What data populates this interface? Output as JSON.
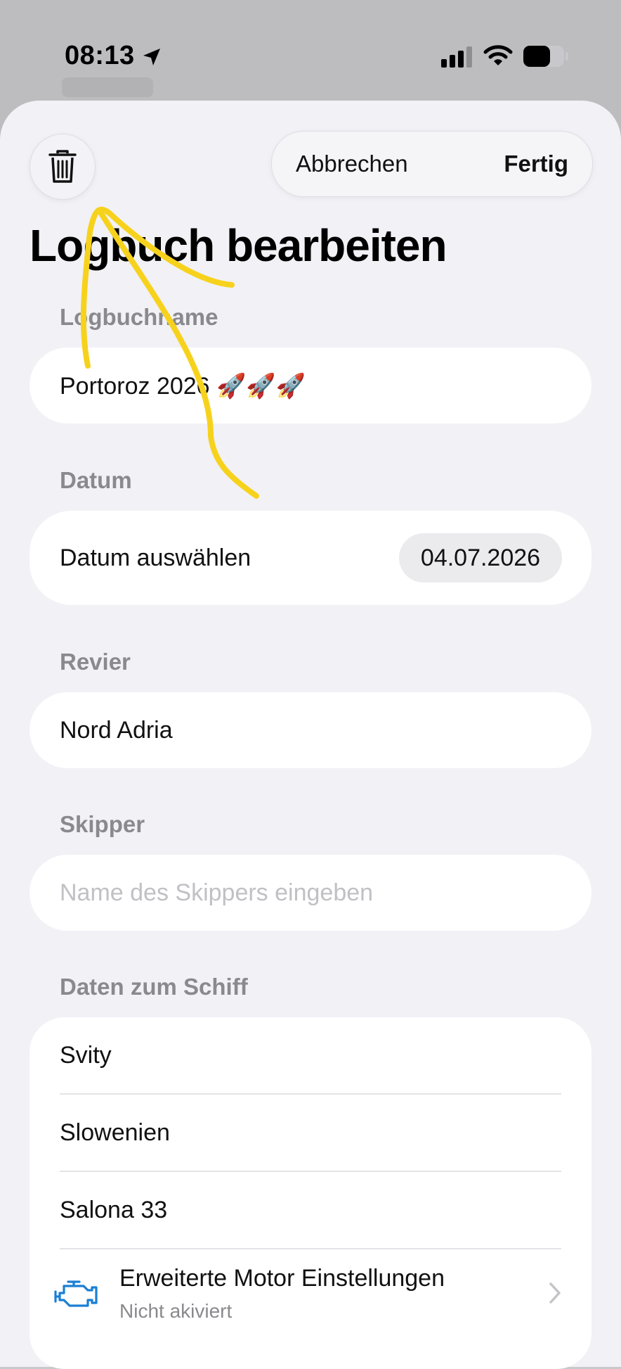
{
  "status_bar": {
    "time": "08:13"
  },
  "header": {
    "delete_icon": "trash-icon",
    "cancel_label": "Abbrechen",
    "done_label": "Fertig"
  },
  "title": "Logbuch bearbeiten",
  "fields": {
    "logbook_name": {
      "label": "Logbuchname",
      "value": "Portoroz 2026 🚀🚀🚀"
    },
    "date": {
      "label": "Datum",
      "row_label": "Datum auswählen",
      "value": "04.07.2026"
    },
    "area": {
      "label": "Revier",
      "value": "Nord Adria"
    },
    "skipper": {
      "label": "Skipper",
      "value": "",
      "placeholder": "Name des Skippers eingeben"
    }
  },
  "ship": {
    "label": "Daten zum Schiff",
    "rows": [
      "Svity",
      "Slowenien",
      "Salona 33"
    ],
    "engine": {
      "title": "Erweiterte Motor Einstellungen",
      "subtitle": "Nicht akiviert",
      "icon": "engine-icon"
    }
  },
  "colors": {
    "accent": "#1a7fd4",
    "annotation": "#f7d21c",
    "background": "#f1f1f6"
  }
}
